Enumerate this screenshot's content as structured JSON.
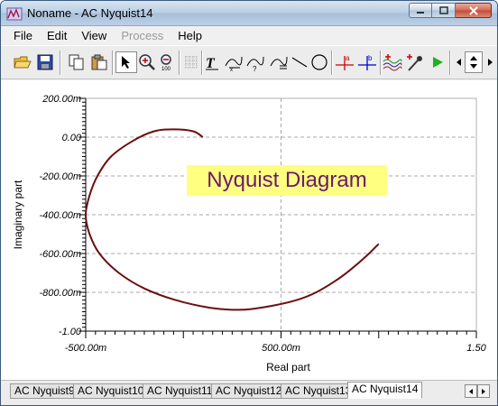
{
  "window": {
    "title": "Noname - AC Nyquist14"
  },
  "menu": [
    {
      "label": "File",
      "enabled": true
    },
    {
      "label": "Edit",
      "enabled": true
    },
    {
      "label": "View",
      "enabled": true
    },
    {
      "label": "Process",
      "enabled": false
    },
    {
      "label": "Help",
      "enabled": true
    }
  ],
  "toolbar": {
    "buttons": [
      "open-icon",
      "save-icon",
      "copy-icon",
      "paste-icon",
      "pointer-icon",
      "zoom-in-icon",
      "zoom-100-icon",
      "grid-icon",
      "text-icon",
      "measure-icon",
      "measure-query-icon",
      "marker-icon",
      "line-icon",
      "circle-icon",
      "cursor-a-icon",
      "cursor-b-icon",
      "waveform-add-icon",
      "probe-icon",
      "run-icon",
      "scroll-left-icon",
      "spin-icon"
    ],
    "run_color": "#22b022"
  },
  "plot": {
    "annotation": "Nyquist Diagram",
    "annotation_bg": "#ffff80",
    "annotation_color": "#6a1b6a",
    "curve_color": "#6b0f0f"
  },
  "chart_data": {
    "type": "line",
    "xlabel": "Real part",
    "ylabel": "Imaginary part",
    "xlim": [
      -0.5,
      1.5
    ],
    "ylim": [
      -1.0,
      0.2
    ],
    "x_tick_labels": [
      "-500.00m",
      "500.00m",
      "1.50"
    ],
    "y_tick_labels": [
      "200.00m",
      "0.00",
      "-200.00m",
      "-400.00m",
      "-600.00m",
      "-800.00m",
      "-1.00"
    ],
    "grid": true,
    "series": [
      {
        "x": [
          0.1,
          0.05,
          -0.05,
          -0.15,
          -0.26,
          -0.37,
          -0.44,
          -0.48,
          -0.5,
          -0.48,
          -0.43,
          -0.33,
          -0.2,
          -0.04,
          0.14,
          0.3,
          0.45,
          0.58,
          0.68,
          0.78,
          0.86,
          0.94,
          1.0
        ],
        "y": [
          0.0,
          0.03,
          0.04,
          0.03,
          -0.02,
          -0.1,
          -0.2,
          -0.3,
          -0.4,
          -0.5,
          -0.6,
          -0.7,
          -0.78,
          -0.84,
          -0.88,
          -0.89,
          -0.87,
          -0.84,
          -0.8,
          -0.74,
          -0.68,
          -0.61,
          -0.55
        ]
      }
    ]
  },
  "tabs": [
    {
      "label": "AC Nyquist9",
      "active": false
    },
    {
      "label": "AC Nyquist10",
      "active": false
    },
    {
      "label": "AC Nyquist11",
      "active": false
    },
    {
      "label": "AC Nyquist12",
      "active": false
    },
    {
      "label": "AC Nyquist13",
      "active": false
    },
    {
      "label": "AC Nyquist14",
      "active": true
    }
  ]
}
